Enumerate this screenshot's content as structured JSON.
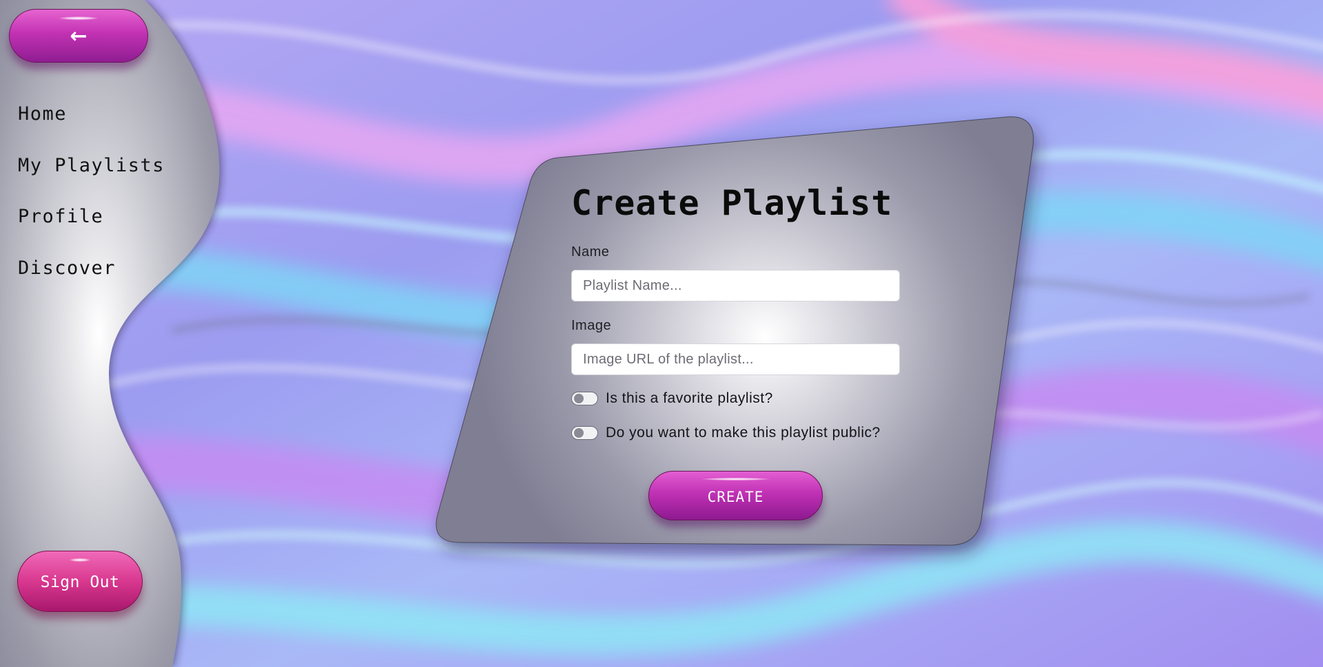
{
  "nav": {
    "back_icon": "left-arrow-icon",
    "back_glyph": "←",
    "items": [
      {
        "label": "Home"
      },
      {
        "label": "My Playlists"
      },
      {
        "label": "Profile"
      },
      {
        "label": "Discover"
      }
    ],
    "sign_out_label": "Sign Out"
  },
  "form": {
    "title": "Create Playlist",
    "name_label": "Name",
    "name_placeholder": "Playlist Name...",
    "image_label": "Image",
    "image_placeholder": "Image URL of the playlist...",
    "favorite_label": "Is this a favorite playlist?",
    "favorite_on": false,
    "public_label": "Do you want to make this playlist public?",
    "public_on": false,
    "create_label": "CREATE"
  },
  "colors": {
    "button_magenta": "#c232b3",
    "signout_pink": "#d9388f",
    "card_gray": "#8e8d9e",
    "background_lavender": "#a99cf0"
  }
}
